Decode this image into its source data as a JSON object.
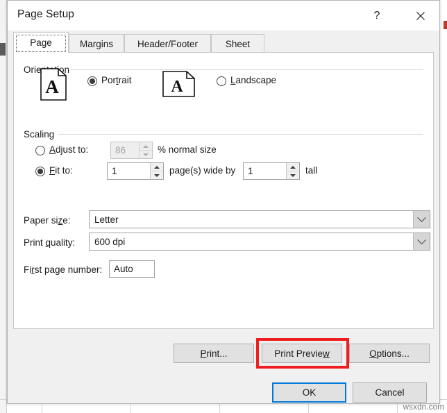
{
  "window": {
    "title": "Page Setup",
    "help_icon": "question-mark-icon",
    "help_glyph": "?",
    "close_icon": "close-icon"
  },
  "tabs": [
    {
      "label": "Page",
      "active": true
    },
    {
      "label": "Margins",
      "active": false
    },
    {
      "label": "Header/Footer",
      "active": false
    },
    {
      "label": "Sheet",
      "active": false
    }
  ],
  "orientation": {
    "group_label": "Orientation",
    "portrait": {
      "label": "Portrait",
      "accel": "t",
      "selected": true,
      "icon": "portrait-page-icon",
      "icon_letter": "A"
    },
    "landscape": {
      "label": "Landscape",
      "accel": "L",
      "selected": false,
      "icon": "landscape-page-icon",
      "icon_letter": "A"
    }
  },
  "scaling": {
    "group_label": "Scaling",
    "adjust_to": {
      "label": "Adjust to:",
      "accel": "A",
      "selected": false,
      "value": "86",
      "disabled": true,
      "suffix": "% normal size"
    },
    "fit_to": {
      "label": "Fit to:",
      "accel": "F",
      "selected": true,
      "wide_value": "1",
      "middle_text": "page(s) wide by",
      "tall_value": "1",
      "tall_text": "tall",
      "disabled": false
    }
  },
  "paper": {
    "paper_size_label": "Paper size:",
    "paper_size_accel": "z",
    "paper_size_value": "Letter",
    "print_quality_label": "Print quality:",
    "print_quality_accel": "q",
    "print_quality_value": "600 dpi",
    "first_page_label": "First page number:",
    "first_page_accel": "r",
    "first_page_value": "Auto",
    "dropdown_icon": "chevron-down-icon"
  },
  "action_buttons": {
    "print": "Print...",
    "print_accel": "P",
    "print_preview": "Print Preview",
    "print_preview_accel": "w",
    "options": "Options...",
    "options_accel": "O",
    "highlighted": "print-preview-button",
    "highlight_color": "#ef1d1d"
  },
  "footer_buttons": {
    "ok": "OK",
    "cancel": "Cancel",
    "default_button": "ok-button",
    "focus_color": "#0078d7"
  },
  "watermark": "wsxdn.com"
}
